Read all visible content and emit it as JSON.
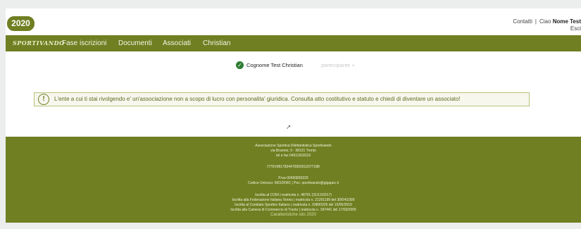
{
  "header": {
    "year_badge": "2020",
    "contacts_link": "Contatti",
    "separator": "|",
    "greeting": "Ciao",
    "user_name": "Nome Test",
    "logout_link": "Esci"
  },
  "nav": {
    "brand": "SPORTIVANDO",
    "items": [
      "Fase iscrizioni",
      "Documenti",
      "Associati",
      "Christian"
    ]
  },
  "participant": {
    "name": "Cognome Test Christian",
    "add_label": "partecipante +"
  },
  "notice": {
    "text": "L'ente a cui ti stai rivolgendo e' un'associazione non a scopo di lucro con personalita' giuridica. Consulta atto costitutivo e statuto e chiedi di diventare un associato!"
  },
  "footer": {
    "org_name": "Associazione Sportiva Dilettantistica Sportivando",
    "address": "via Brunner, 9 - 38121 Trento",
    "phone": "tel e fax 04611918118",
    "iban": "IT76V0817834470000012077188",
    "vat": "P.iva 00690830229",
    "codes": "Codice Univoco: 66OZKW1 | Pec: sportivando@gigapec.it",
    "reg1": "Iscritta al CONI | matricola n. 48701 (31/12/2017)",
    "reg2": "Iscritta alla Federazione Italiana Tennis | matricola n. 21291199 del 30/04/1999",
    "reg3": "Iscritta al Comitato Sportivo Italiano | matricola n. 03800326 del 15/05/2019",
    "reg4": "Iscritta alla Camera di Commercio di Trento | matricola n. 187441 del 17/03/2005",
    "site_link": "Caratteristiche sito 2020"
  }
}
